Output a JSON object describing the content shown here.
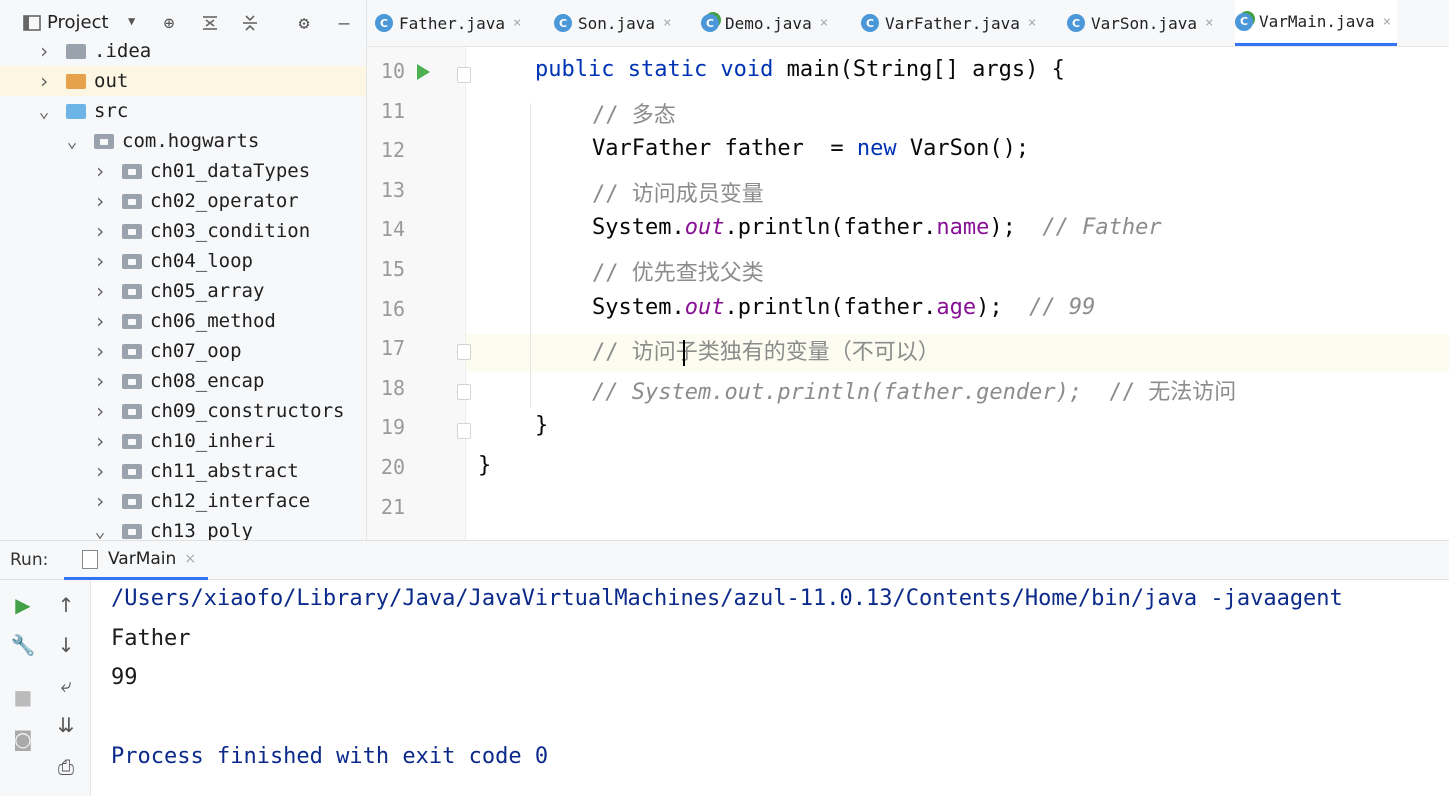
{
  "project_panel": {
    "title": "Project",
    "tree": [
      {
        "label": ".idea",
        "depth": 0,
        "chevron": ">",
        "folder": "gray"
      },
      {
        "label": "out",
        "depth": 0,
        "chevron": ">",
        "folder": "orange",
        "highlight": true
      },
      {
        "label": "src",
        "depth": 0,
        "chevron": "v",
        "folder": "blue"
      },
      {
        "label": "com.hogwarts",
        "depth": 1,
        "chevron": "v",
        "folder": "pkg"
      },
      {
        "label": "ch01_dataTypes",
        "depth": 2,
        "chevron": ">",
        "folder": "pkg"
      },
      {
        "label": "ch02_operator",
        "depth": 2,
        "chevron": ">",
        "folder": "pkg"
      },
      {
        "label": "ch03_condition",
        "depth": 2,
        "chevron": ">",
        "folder": "pkg"
      },
      {
        "label": "ch04_loop",
        "depth": 2,
        "chevron": ">",
        "folder": "pkg"
      },
      {
        "label": "ch05_array",
        "depth": 2,
        "chevron": ">",
        "folder": "pkg"
      },
      {
        "label": "ch06_method",
        "depth": 2,
        "chevron": ">",
        "folder": "pkg"
      },
      {
        "label": "ch07_oop",
        "depth": 2,
        "chevron": ">",
        "folder": "pkg"
      },
      {
        "label": "ch08_encap",
        "depth": 2,
        "chevron": ">",
        "folder": "pkg"
      },
      {
        "label": "ch09_constructors",
        "depth": 2,
        "chevron": ">",
        "folder": "pkg"
      },
      {
        "label": "ch10_inheri",
        "depth": 2,
        "chevron": ">",
        "folder": "pkg"
      },
      {
        "label": "ch11_abstract",
        "depth": 2,
        "chevron": ">",
        "folder": "pkg"
      },
      {
        "label": "ch12_interface",
        "depth": 2,
        "chevron": ">",
        "folder": "pkg"
      },
      {
        "label": "ch13_poly",
        "depth": 2,
        "chevron": "v",
        "folder": "pkg"
      }
    ]
  },
  "tabs": [
    {
      "label": "Father.java",
      "icon": "C",
      "active": false
    },
    {
      "label": "Son.java",
      "icon": "C",
      "active": false
    },
    {
      "label": "Demo.java",
      "icon": "C",
      "active": false
    },
    {
      "label": "VarFather.java",
      "icon": "C",
      "active": false
    },
    {
      "label": "VarSon.java",
      "icon": "C",
      "active": false
    },
    {
      "label": "VarMain.java",
      "icon": "C",
      "active": true
    }
  ],
  "editor": {
    "line_numbers": [
      "10",
      "11",
      "12",
      "13",
      "14",
      "15",
      "16",
      "17",
      "18",
      "19",
      "20",
      "21"
    ],
    "lines": [
      [
        {
          "t": "public static void ",
          "c": "kw"
        },
        {
          "t": "main(String[] args) {",
          "c": ""
        }
      ],
      [
        {
          "t": "// 多态",
          "c": "cm"
        }
      ],
      [
        {
          "t": "VarFather father  = ",
          "c": ""
        },
        {
          "t": "new ",
          "c": "kw"
        },
        {
          "t": "VarSon();",
          "c": ""
        }
      ],
      [
        {
          "t": "// 访问成员变量",
          "c": "cm"
        }
      ],
      [
        {
          "t": "System.",
          "c": ""
        },
        {
          "t": "out",
          "c": "st"
        },
        {
          "t": ".println(father.",
          "c": ""
        },
        {
          "t": "name",
          "c": "field"
        },
        {
          "t": ");  ",
          "c": ""
        },
        {
          "t": "// Father",
          "c": "cm it"
        }
      ],
      [
        {
          "t": "// 优先查找父类",
          "c": "cm"
        }
      ],
      [
        {
          "t": "System.",
          "c": ""
        },
        {
          "t": "out",
          "c": "st"
        },
        {
          "t": ".println(father.",
          "c": ""
        },
        {
          "t": "age",
          "c": "field"
        },
        {
          "t": ");  ",
          "c": ""
        },
        {
          "t": "// 99",
          "c": "cm it"
        }
      ],
      [
        {
          "t": "// 访问子类独有的变量（不可以）",
          "c": "cm"
        }
      ],
      [
        {
          "t": "// System.out.println(father.gender);  ",
          "c": "cm it"
        },
        {
          "t": "// 无法访问",
          "c": "cm"
        }
      ],
      [
        {
          "t": "}",
          "c": ""
        }
      ],
      [
        {
          "t": "}",
          "c": ""
        }
      ],
      []
    ]
  },
  "run_panel": {
    "label": "Run:",
    "tab": "VarMain",
    "output": [
      "/Users/xiaofo/Library/Java/JavaVirtualMachines/azul-11.0.13/Contents/Home/bin/java -javaagent",
      "Father",
      "99",
      "",
      "Process finished with exit code 0"
    ]
  },
  "colors": {
    "accent": "#3574f0",
    "keyword": "#0033b3",
    "comment": "#8c8c8c",
    "field": "#871094"
  }
}
